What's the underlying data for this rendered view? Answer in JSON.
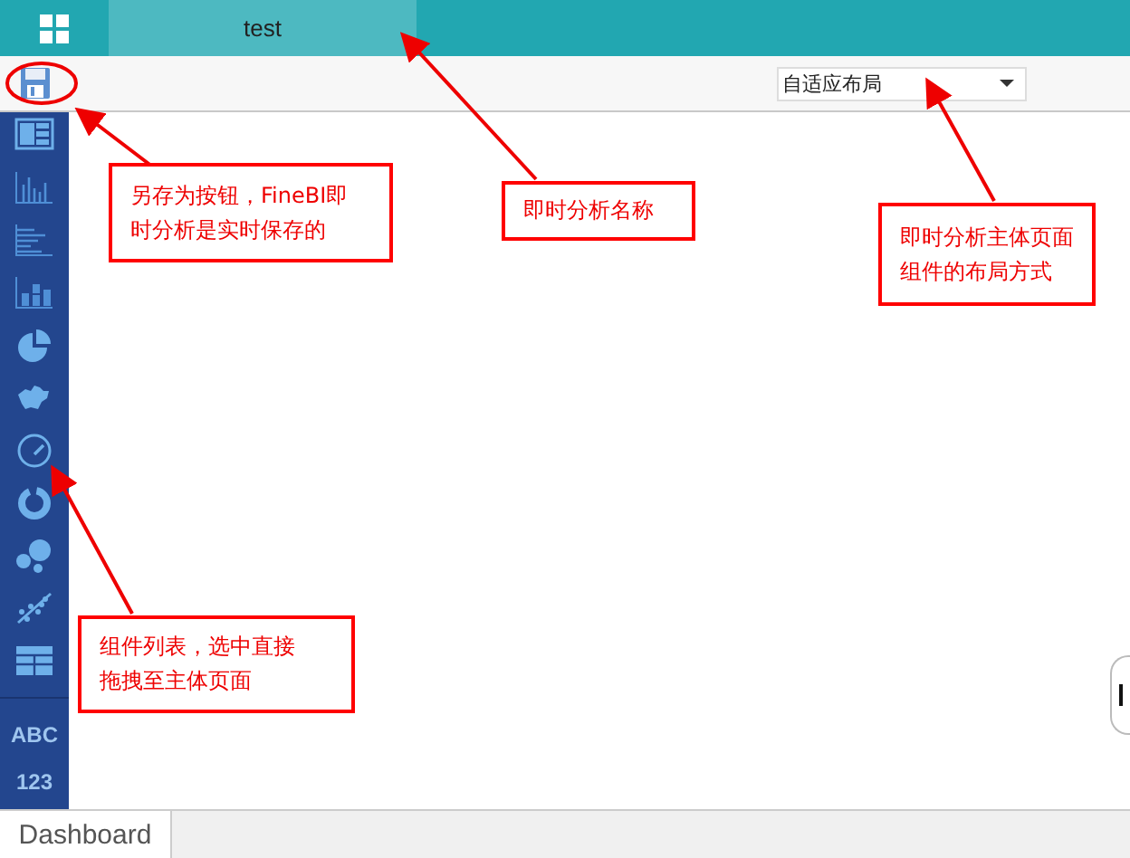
{
  "top_bar": {
    "tab": {
      "label": "test",
      "selected": true
    }
  },
  "toolbar": {
    "layout_dropdown": {
      "value": "自适应布局"
    }
  },
  "sidebar": {
    "text_widgets": [
      "ABC",
      "123"
    ]
  },
  "bottom_tabs": [
    {
      "label": "Dashboard",
      "selected": true
    }
  ],
  "annotations": [
    {
      "lines": [
        "另存为按钮，FineBI即",
        "时分析是实时保存的"
      ]
    },
    {
      "lines": [
        "即时分析名称"
      ]
    },
    {
      "lines": [
        "即时分析主体页面",
        "组件的布局方式"
      ]
    },
    {
      "lines": [
        "组件列表，选中直接",
        "拖拽至主体页面"
      ]
    }
  ]
}
